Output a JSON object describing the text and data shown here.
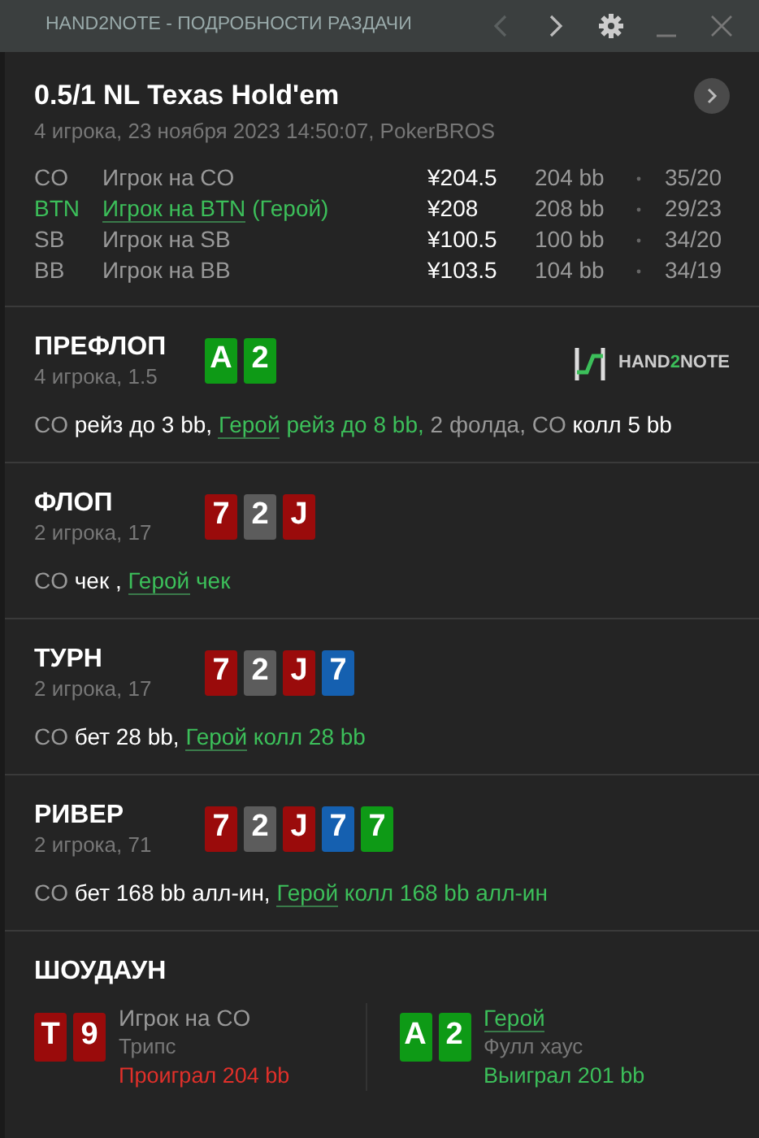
{
  "window": {
    "title": "HAND2NOTE - ПОДРОБНОСТИ РАЗДАЧИ",
    "prev_disabled": true
  },
  "hand": {
    "title": "0.5/1 NL Texas Hold'em",
    "subtitle": "4 игрока, 23 ноября 2023 14:50:07, PokerBROS"
  },
  "players": [
    {
      "position": "CO",
      "name": "Игрок на CO",
      "hero": false,
      "stack": "¥204.5",
      "bb": "204 bb",
      "stats": "35/20"
    },
    {
      "position": "BTN",
      "name": "Игрок на BTN",
      "hero_label": "(Герой)",
      "hero": true,
      "stack": "¥208",
      "bb": "208 bb",
      "stats": "29/23"
    },
    {
      "position": "SB",
      "name": "Игрок на SB",
      "hero": false,
      "stack": "¥100.5",
      "bb": "100 bb",
      "stats": "34/20"
    },
    {
      "position": "BB",
      "name": "Игрок на BB",
      "hero": false,
      "stack": "¥103.5",
      "bb": "104 bb",
      "stats": "34/19"
    }
  ],
  "streets": [
    {
      "name": "ПРЕФЛОП",
      "info": "4 игрока, 1.5",
      "logo": {
        "before": "HAND",
        "accent": "2",
        "after": "NOTE"
      },
      "cards": [
        {
          "rank": "A",
          "color": "#0e9a16"
        },
        {
          "rank": "2",
          "color": "#0e9a16"
        }
      ],
      "actions": [
        {
          "text": "CO",
          "kind": "player"
        },
        {
          "text": "рейз до 3 bb,",
          "kind": "action"
        },
        {
          "text": "Герой",
          "kind": "hero"
        },
        {
          "text": "рейз до 8 bb,",
          "kind": "hero_action"
        },
        {
          "text": "2 фолда, CO",
          "kind": "player"
        },
        {
          "text": "колл 5 bb",
          "kind": "action"
        }
      ]
    },
    {
      "name": "ФЛОП",
      "info": "2 игрока, 17",
      "cards": [
        {
          "rank": "7",
          "color": "#9a0b0b"
        },
        {
          "rank": "2",
          "color": "#5c5c5c"
        },
        {
          "rank": "J",
          "color": "#9a0b0b"
        }
      ],
      "actions": [
        {
          "text": "CO",
          "kind": "player"
        },
        {
          "text": "чек ,",
          "kind": "action"
        },
        {
          "text": "Герой",
          "kind": "hero"
        },
        {
          "text": "чек",
          "kind": "hero_action"
        }
      ]
    },
    {
      "name": "ТУРН",
      "info": "2 игрока, 17",
      "cards": [
        {
          "rank": "7",
          "color": "#9a0b0b"
        },
        {
          "rank": "2",
          "color": "#5c5c5c"
        },
        {
          "rank": "J",
          "color": "#9a0b0b"
        },
        {
          "rank": "7",
          "color": "#1560b0"
        }
      ],
      "actions": [
        {
          "text": "CO",
          "kind": "player"
        },
        {
          "text": "бет 28 bb,",
          "kind": "action"
        },
        {
          "text": "Герой",
          "kind": "hero"
        },
        {
          "text": "колл 28 bb",
          "kind": "hero_action"
        }
      ]
    },
    {
      "name": "РИВЕР",
      "info": "2 игрока, 71",
      "cards": [
        {
          "rank": "7",
          "color": "#9a0b0b"
        },
        {
          "rank": "2",
          "color": "#5c5c5c"
        },
        {
          "rank": "J",
          "color": "#9a0b0b"
        },
        {
          "rank": "7",
          "color": "#1560b0"
        },
        {
          "rank": "7",
          "color": "#0e9a16"
        }
      ],
      "actions": [
        {
          "text": "CO",
          "kind": "player"
        },
        {
          "text": "бет 168 bb алл-ин,",
          "kind": "action"
        },
        {
          "text": "Герой",
          "kind": "hero"
        },
        {
          "text": "колл 168 bb алл-ин",
          "kind": "hero_action"
        }
      ]
    }
  ],
  "showdown": {
    "title": "ШОУДАУН",
    "players": [
      {
        "name": "Игрок на CO",
        "hero": false,
        "hand": "Трипс",
        "result": "Проиграл 204 bb",
        "won": false,
        "cards": [
          {
            "rank": "T",
            "color": "#9a0b0b"
          },
          {
            "rank": "9",
            "color": "#9a0b0b"
          }
        ]
      },
      {
        "name": "Герой",
        "hero": true,
        "hand": "Фулл хаус",
        "result": "Выиграл 201 bb",
        "won": true,
        "cards": [
          {
            "rank": "A",
            "color": "#0e9a16"
          },
          {
            "rank": "2",
            "color": "#0e9a16"
          }
        ]
      }
    ]
  }
}
